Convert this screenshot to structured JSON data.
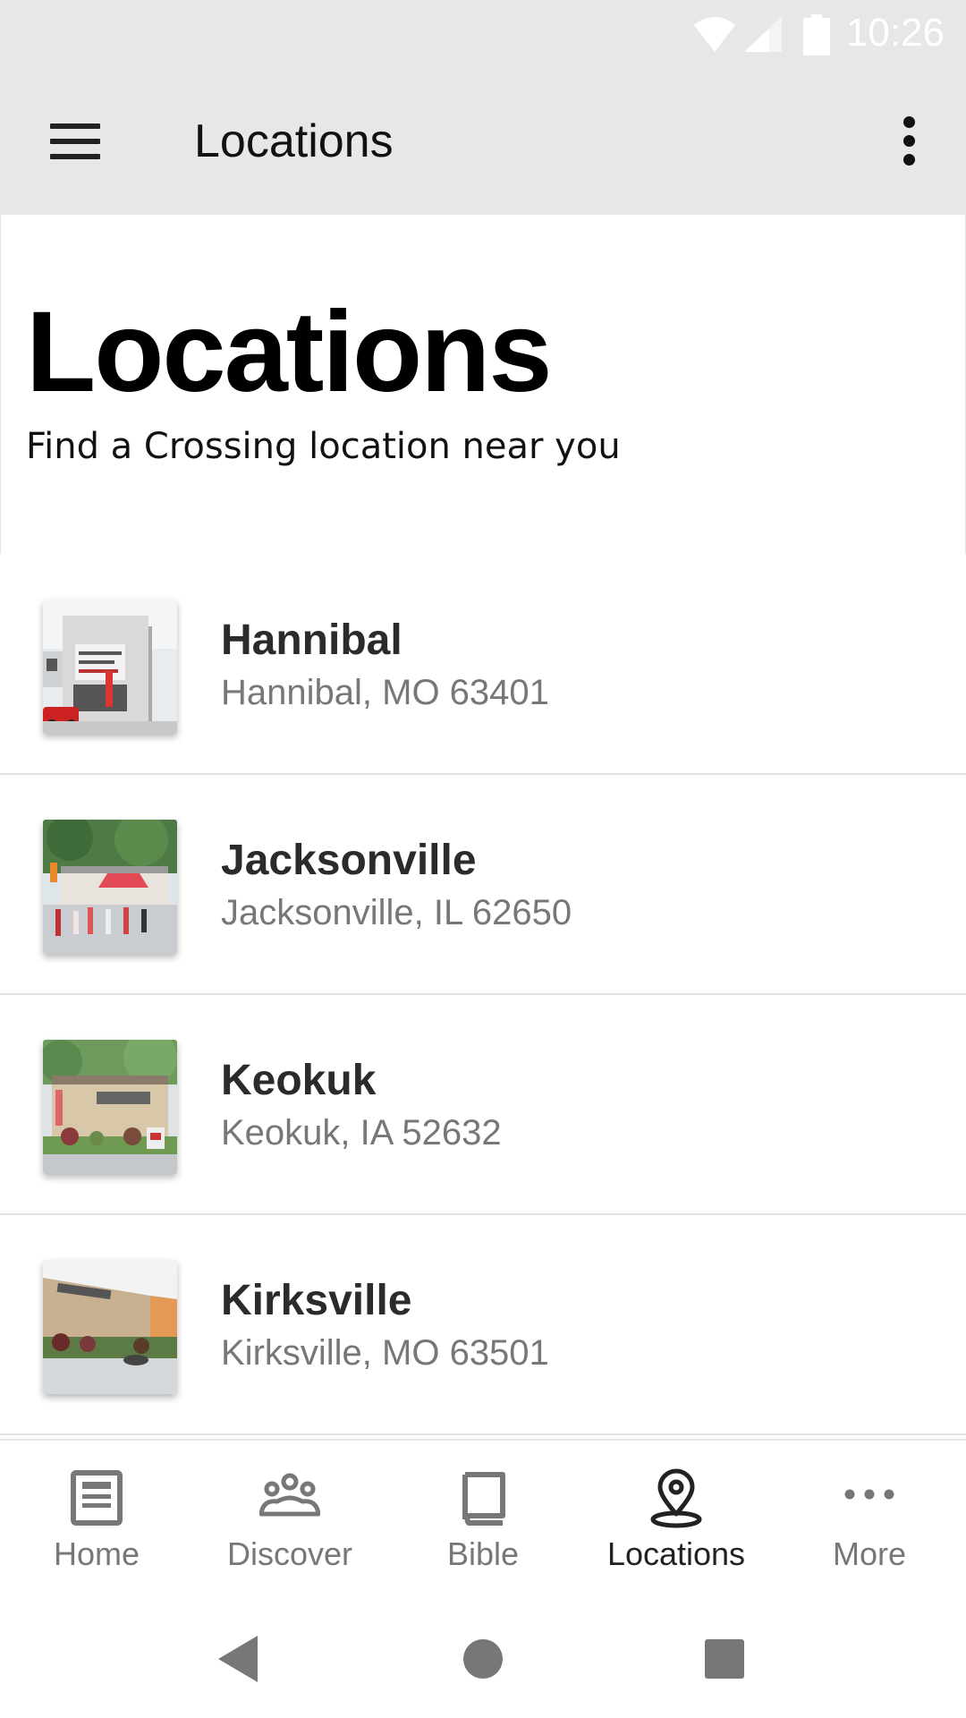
{
  "status_bar": {
    "time": "10:26"
  },
  "app_bar": {
    "title": "Locations",
    "menu_icon": "hamburger-menu-icon",
    "overflow_icon": "more-vert-icon"
  },
  "header": {
    "title": "Locations",
    "subtitle": "Find a Crossing location near you"
  },
  "locations": [
    {
      "name": "Hannibal",
      "address": "Hannibal, MO 63401"
    },
    {
      "name": "Jacksonville",
      "address": "Jacksonville, IL 62650"
    },
    {
      "name": "Keokuk",
      "address": "Keokuk, IA 52632"
    },
    {
      "name": "Kirksville",
      "address": "Kirksville, MO 63501"
    }
  ],
  "bottom_nav": {
    "items": [
      {
        "label": "Home",
        "icon": "home-document-icon"
      },
      {
        "label": "Discover",
        "icon": "people-group-icon"
      },
      {
        "label": "Bible",
        "icon": "book-icon"
      },
      {
        "label": "Locations",
        "icon": "map-pin-icon",
        "active": true
      },
      {
        "label": "More",
        "icon": "more-horiz-icon"
      }
    ]
  },
  "colors": {
    "bar_background": "#e6e7e9",
    "active": "#222222",
    "inactive": "#777777"
  }
}
